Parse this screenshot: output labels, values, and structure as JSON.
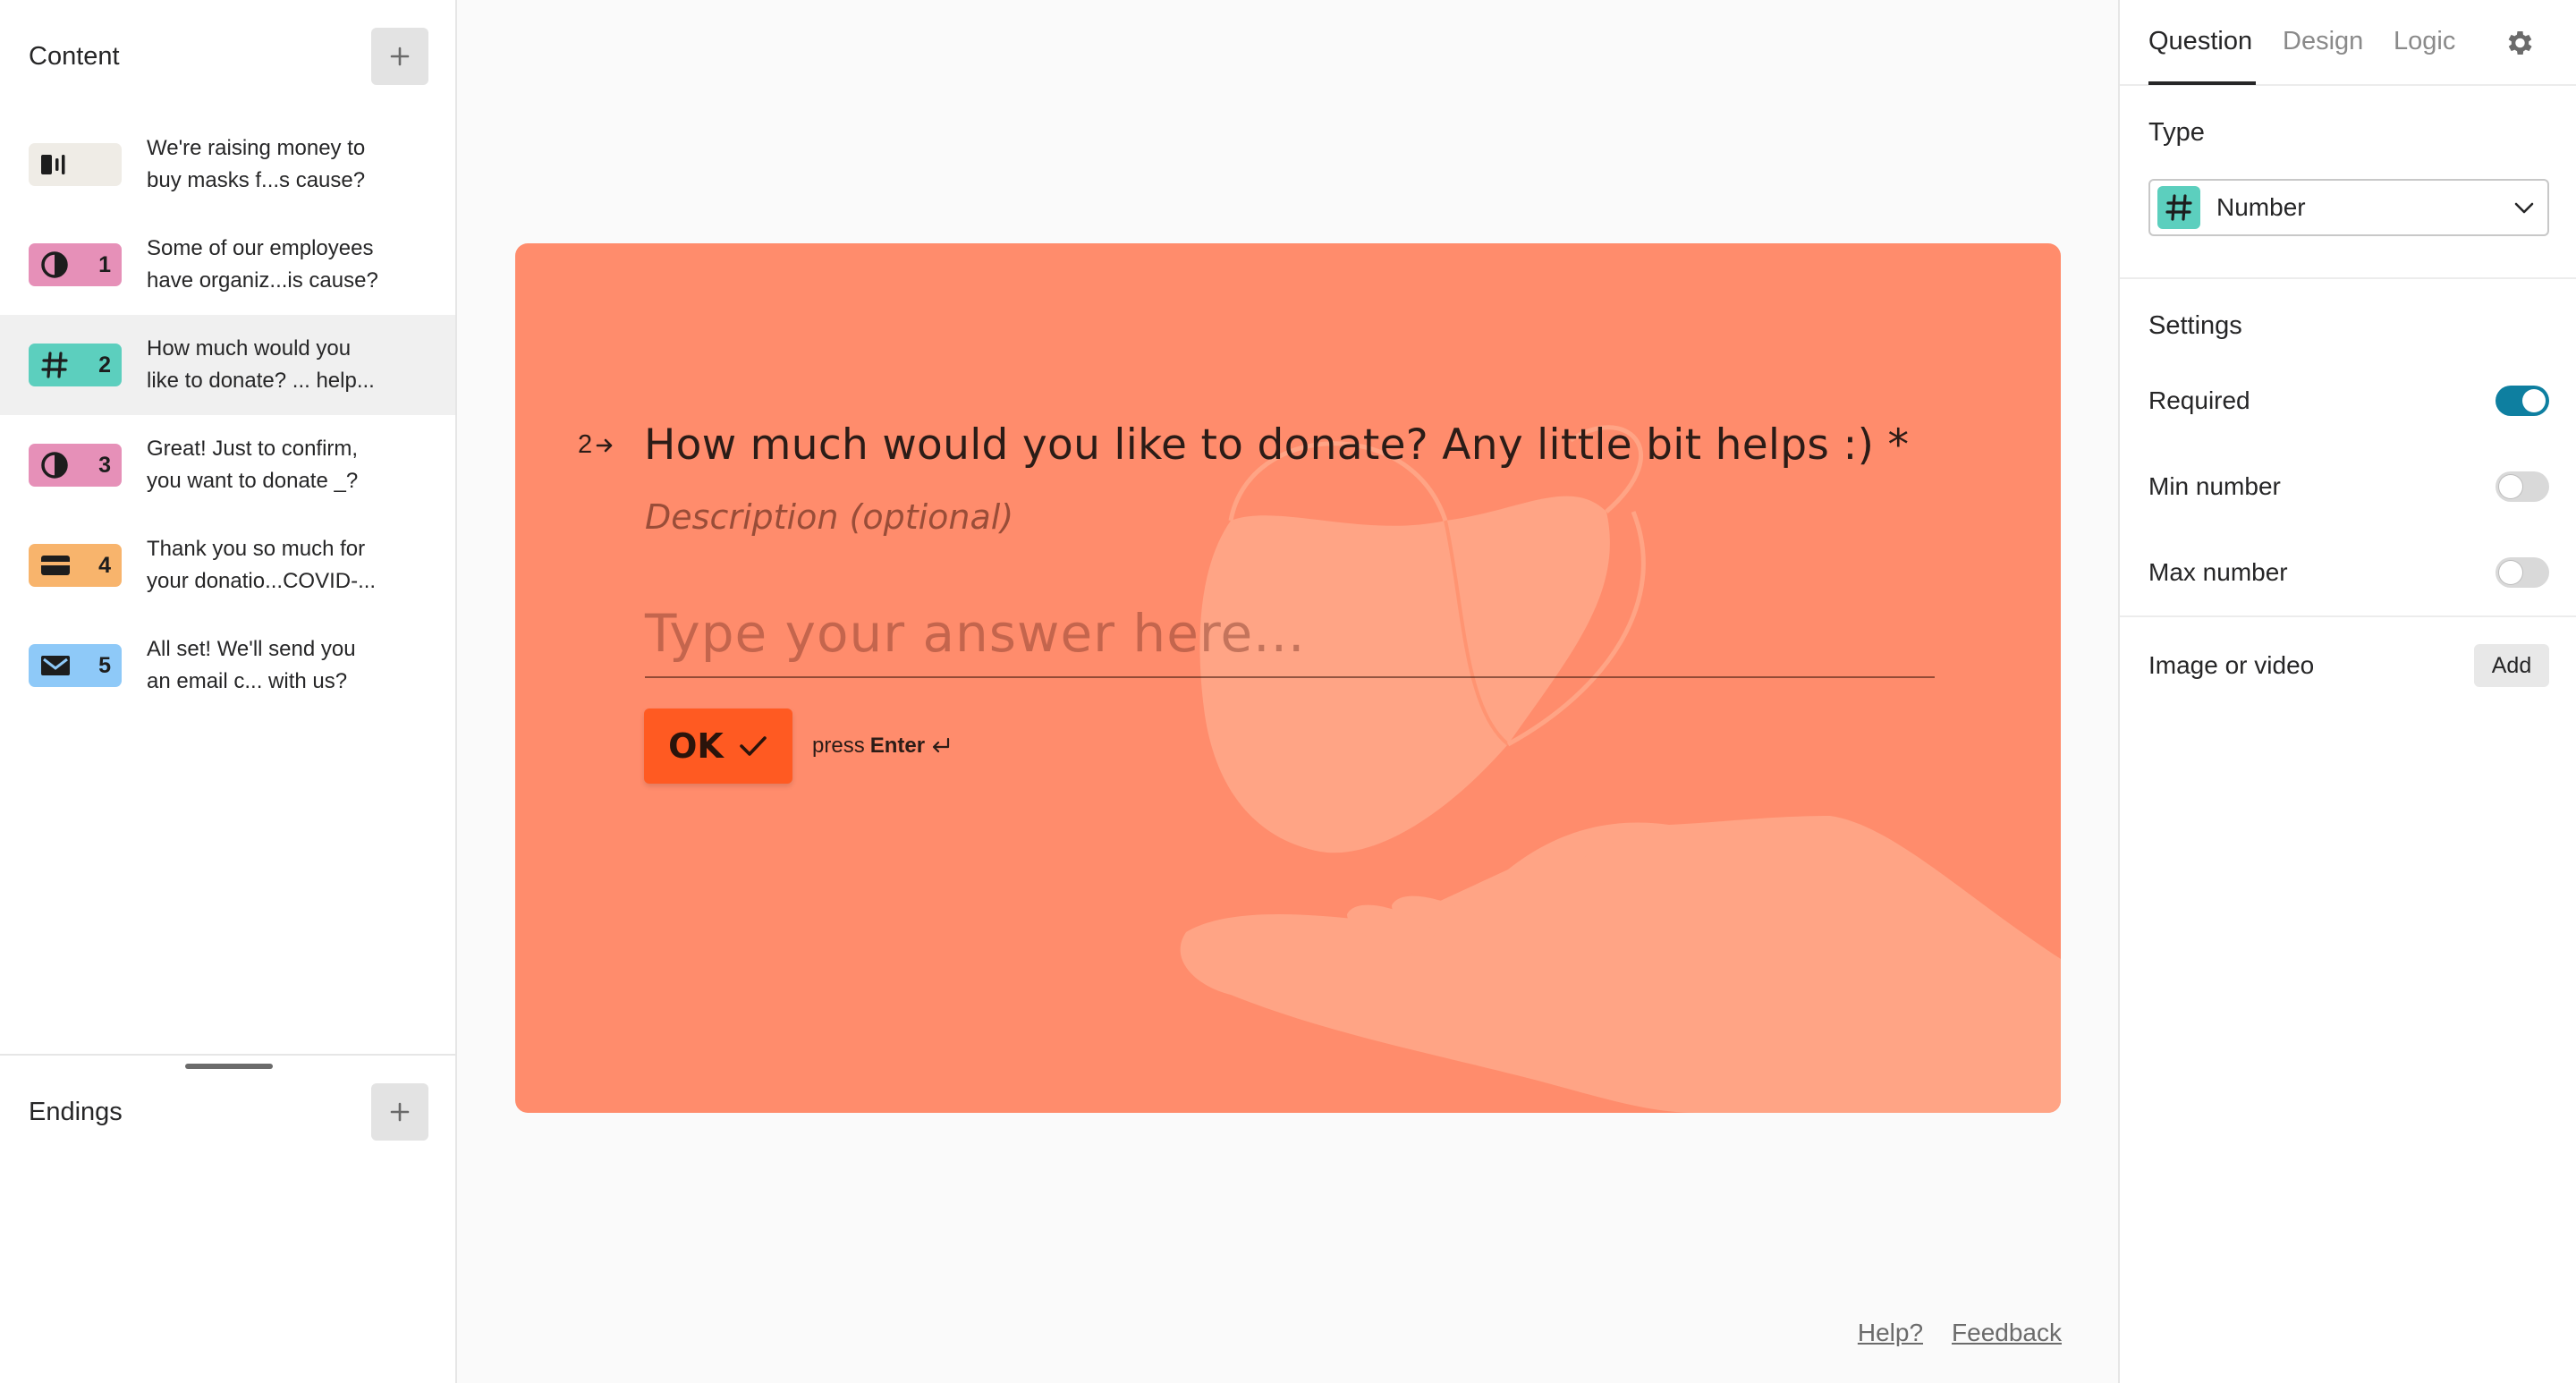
{
  "sidebar": {
    "title": "Content",
    "items": [
      {
        "line1": "We're raising money to",
        "line2": "buy masks f...s cause?",
        "number": "",
        "icon": "statement-icon",
        "color": "#efece6"
      },
      {
        "line1": "Some of our employees",
        "line2": "have organiz...is cause?",
        "number": "1",
        "icon": "yes-no-icon",
        "color": "#e690b8"
      },
      {
        "line1": "How much would you",
        "line2": "like to donate? ... help...",
        "number": "2",
        "icon": "hash-icon",
        "color": "#5ccfbe"
      },
      {
        "line1": "Great! Just to confirm,",
        "line2": "you want to donate _?",
        "number": "3",
        "icon": "yes-no-icon",
        "color": "#e690b8"
      },
      {
        "line1": "Thank you so much for",
        "line2": "your donatio...COVID-...",
        "number": "4",
        "icon": "payment-icon",
        "color": "#f8b46c"
      },
      {
        "line1": "All set! We'll send you",
        "line2": "an email c... with us?",
        "number": "5",
        "icon": "email-icon",
        "color": "#8ec9f8"
      }
    ],
    "endings_title": "Endings"
  },
  "question": {
    "number": "2",
    "text": "How much would you like to donate? Any little bit helps :) *",
    "description_placeholder": "Description (optional)",
    "answer_placeholder": "Type your answer here...",
    "ok_label": "OK",
    "press_text": "press",
    "press_key": "Enter",
    "card_color": "#ff8c6c",
    "button_color": "#ff5a22"
  },
  "footer": {
    "help": "Help?",
    "feedback": "Feedback"
  },
  "panel": {
    "tabs": [
      "Question",
      "Design",
      "Logic"
    ],
    "active_tab": "Question",
    "type_label": "Type",
    "type_value": "Number",
    "settings_label": "Settings",
    "settings": [
      {
        "label": "Required",
        "on": true
      },
      {
        "label": "Min number",
        "on": false
      },
      {
        "label": "Max number",
        "on": false
      }
    ],
    "media_label": "Image or video",
    "media_button": "Add",
    "accent": "#0e7fa0"
  }
}
